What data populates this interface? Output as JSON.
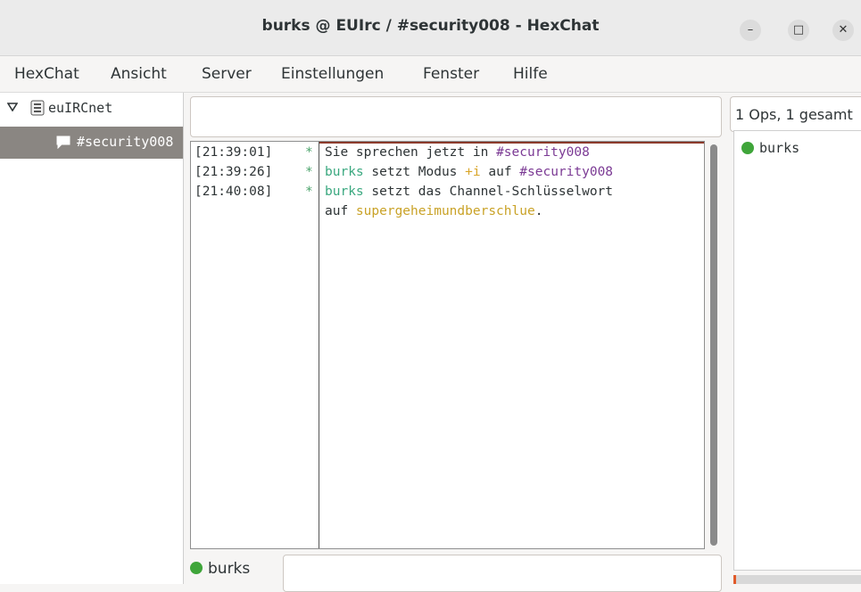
{
  "window": {
    "title": "burks @ EUIrc / #security008 - HexChat"
  },
  "menu": [
    "HexChat",
    "Ansicht",
    "Server",
    "Einstellungen",
    "Fenster",
    "Hilfe"
  ],
  "tree": {
    "server": "euIRCnet",
    "channel": "#security008"
  },
  "chat": {
    "lines": [
      {
        "time": "[21:39:01]",
        "star": "*",
        "parts": [
          "Sie sprechen jetzt in ",
          "#security008"
        ]
      },
      {
        "time": "[21:39:26]",
        "star": "*",
        "parts": [
          "burks",
          " setzt Modus ",
          "+i",
          " auf ",
          "#security008"
        ]
      },
      {
        "time": "[21:40:08]",
        "star": "*",
        "parts": [
          "burks",
          " setzt das Channel-Schlüsselwort"
        ]
      },
      {
        "time": "",
        "star": "",
        "parts": [
          "auf ",
          "supergeheimundberschlue",
          "."
        ]
      }
    ]
  },
  "users": {
    "header": "1 Ops, 1 gesamt",
    "list": [
      "burks"
    ]
  },
  "input": {
    "nick": "burks",
    "value": ""
  },
  "colors": {
    "nick": "#3aa87f",
    "channel": "#7b3a94",
    "mode": "#d9a62a",
    "key": "#c9a227",
    "op_dot": "#3fa53a"
  }
}
